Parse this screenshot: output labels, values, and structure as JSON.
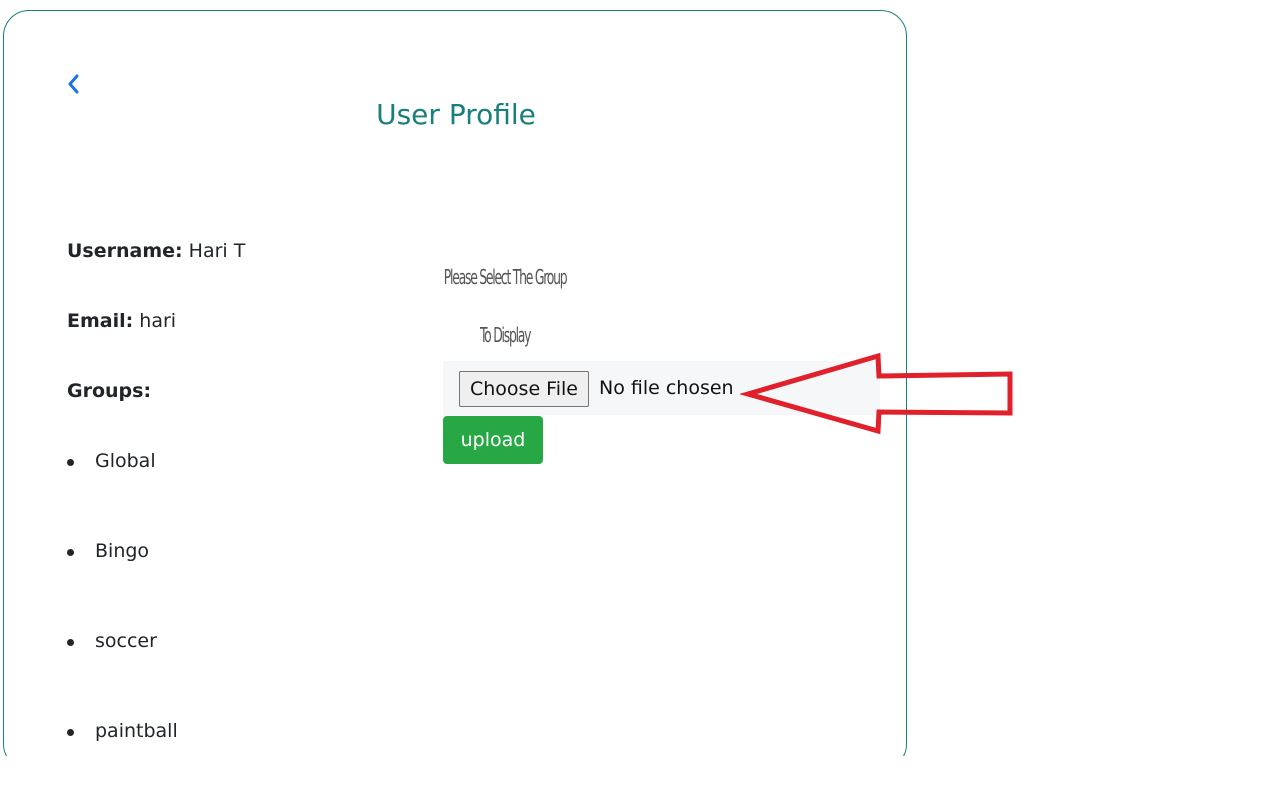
{
  "page": {
    "title": "User Profile",
    "back_icon": "chevron-left-icon"
  },
  "profile": {
    "username_label": "Username:",
    "username_value": "Hari T",
    "email_label": "Email:",
    "email_value": "hari",
    "groups_label": "Groups:",
    "groups": [
      "Global",
      "Bingo",
      "soccer",
      "paintball"
    ]
  },
  "upload": {
    "placeholder_image_text": "Please Select The Group To Display",
    "choose_file_label": "Choose File",
    "no_file_text": "No file chosen",
    "upload_label": "upload"
  },
  "annotation": {
    "arrow_color": "#e0202a"
  },
  "colors": {
    "accent": "#187f7b",
    "back_link": "#1a73e8",
    "upload_button": "#28a745"
  }
}
